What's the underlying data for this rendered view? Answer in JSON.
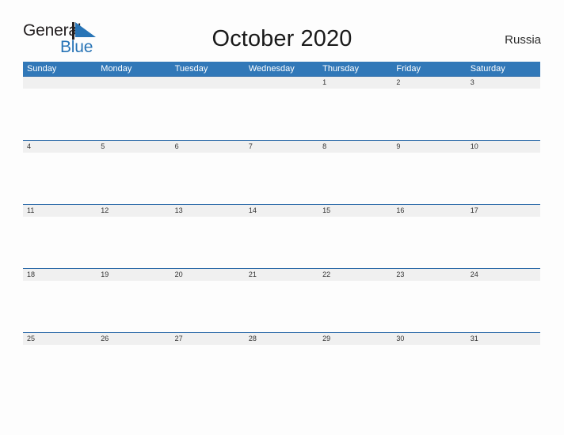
{
  "brand": {
    "name_part1": "General",
    "name_part2": "Blue",
    "flag_icon": "blue-triangle-flag-icon",
    "color_dark": "#231f20",
    "color_blue": "#2874b6"
  },
  "header": {
    "title": "October 2020",
    "country": "Russia"
  },
  "colors": {
    "header_blue": "#3178b8",
    "row_border_blue": "#2a69a8",
    "day_band_gray": "#f0f0f0",
    "page_background": "#fdfdfd"
  },
  "calendar": {
    "month": "October",
    "year": "2020",
    "weekday_headers": [
      "Sunday",
      "Monday",
      "Tuesday",
      "Wednesday",
      "Thursday",
      "Friday",
      "Saturday"
    ],
    "weeks": [
      [
        "",
        "",
        "",
        "",
        "1",
        "2",
        "3"
      ],
      [
        "4",
        "5",
        "6",
        "7",
        "8",
        "9",
        "10"
      ],
      [
        "11",
        "12",
        "13",
        "14",
        "15",
        "16",
        "17"
      ],
      [
        "18",
        "19",
        "20",
        "21",
        "22",
        "23",
        "24"
      ],
      [
        "25",
        "26",
        "27",
        "28",
        "29",
        "30",
        "31"
      ]
    ]
  }
}
